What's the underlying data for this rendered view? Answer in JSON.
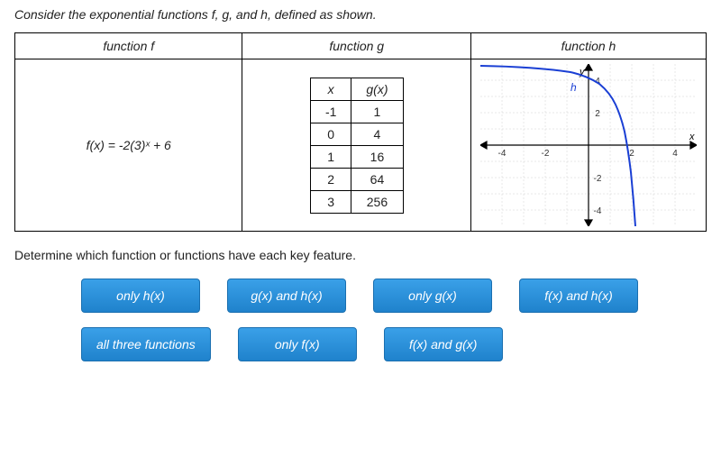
{
  "prompt": "Consider the exponential functions f, g, and h, defined as shown.",
  "headers": {
    "f": "function f",
    "g": "function g",
    "h": "function h"
  },
  "function_f": {
    "formula": "f(x) = -2(3)ˣ + 6"
  },
  "function_g": {
    "col_x": "x",
    "col_gx": "g(x)",
    "rows": [
      {
        "x": "-1",
        "gx": "1"
      },
      {
        "x": "0",
        "gx": "4"
      },
      {
        "x": "1",
        "gx": "16"
      },
      {
        "x": "2",
        "gx": "64"
      },
      {
        "x": "3",
        "gx": "256"
      }
    ]
  },
  "function_h": {
    "axis_x": "x",
    "axis_y": "y",
    "curve_label": "h",
    "ticks": {
      "x": [
        -4,
        -2,
        2,
        4
      ],
      "y": [
        -4,
        -2,
        2,
        4
      ]
    }
  },
  "question": "Determine which function or functions have each key feature.",
  "tiles": [
    "only h(x)",
    "g(x) and h(x)",
    "only g(x)",
    "f(x) and h(x)",
    "all three functions",
    "only f(x)",
    "f(x) and g(x)"
  ],
  "chart_data": {
    "type": "line",
    "title": "",
    "xlabel": "x",
    "ylabel": "y",
    "xlim": [
      -5,
      5
    ],
    "ylim": [
      -5,
      5
    ],
    "series": [
      {
        "name": "h",
        "x": [
          -5,
          -4,
          -3,
          -2,
          -1,
          0,
          0.5,
          1,
          1.4,
          1.7,
          2
        ],
        "y": [
          5,
          4.97,
          4.93,
          4.85,
          4.7,
          4.3,
          3.8,
          3,
          1.6,
          -0.3,
          -5
        ]
      }
    ],
    "x_ticks": [
      -4,
      -2,
      2,
      4
    ],
    "y_ticks": [
      -4,
      -2,
      2,
      4
    ]
  }
}
